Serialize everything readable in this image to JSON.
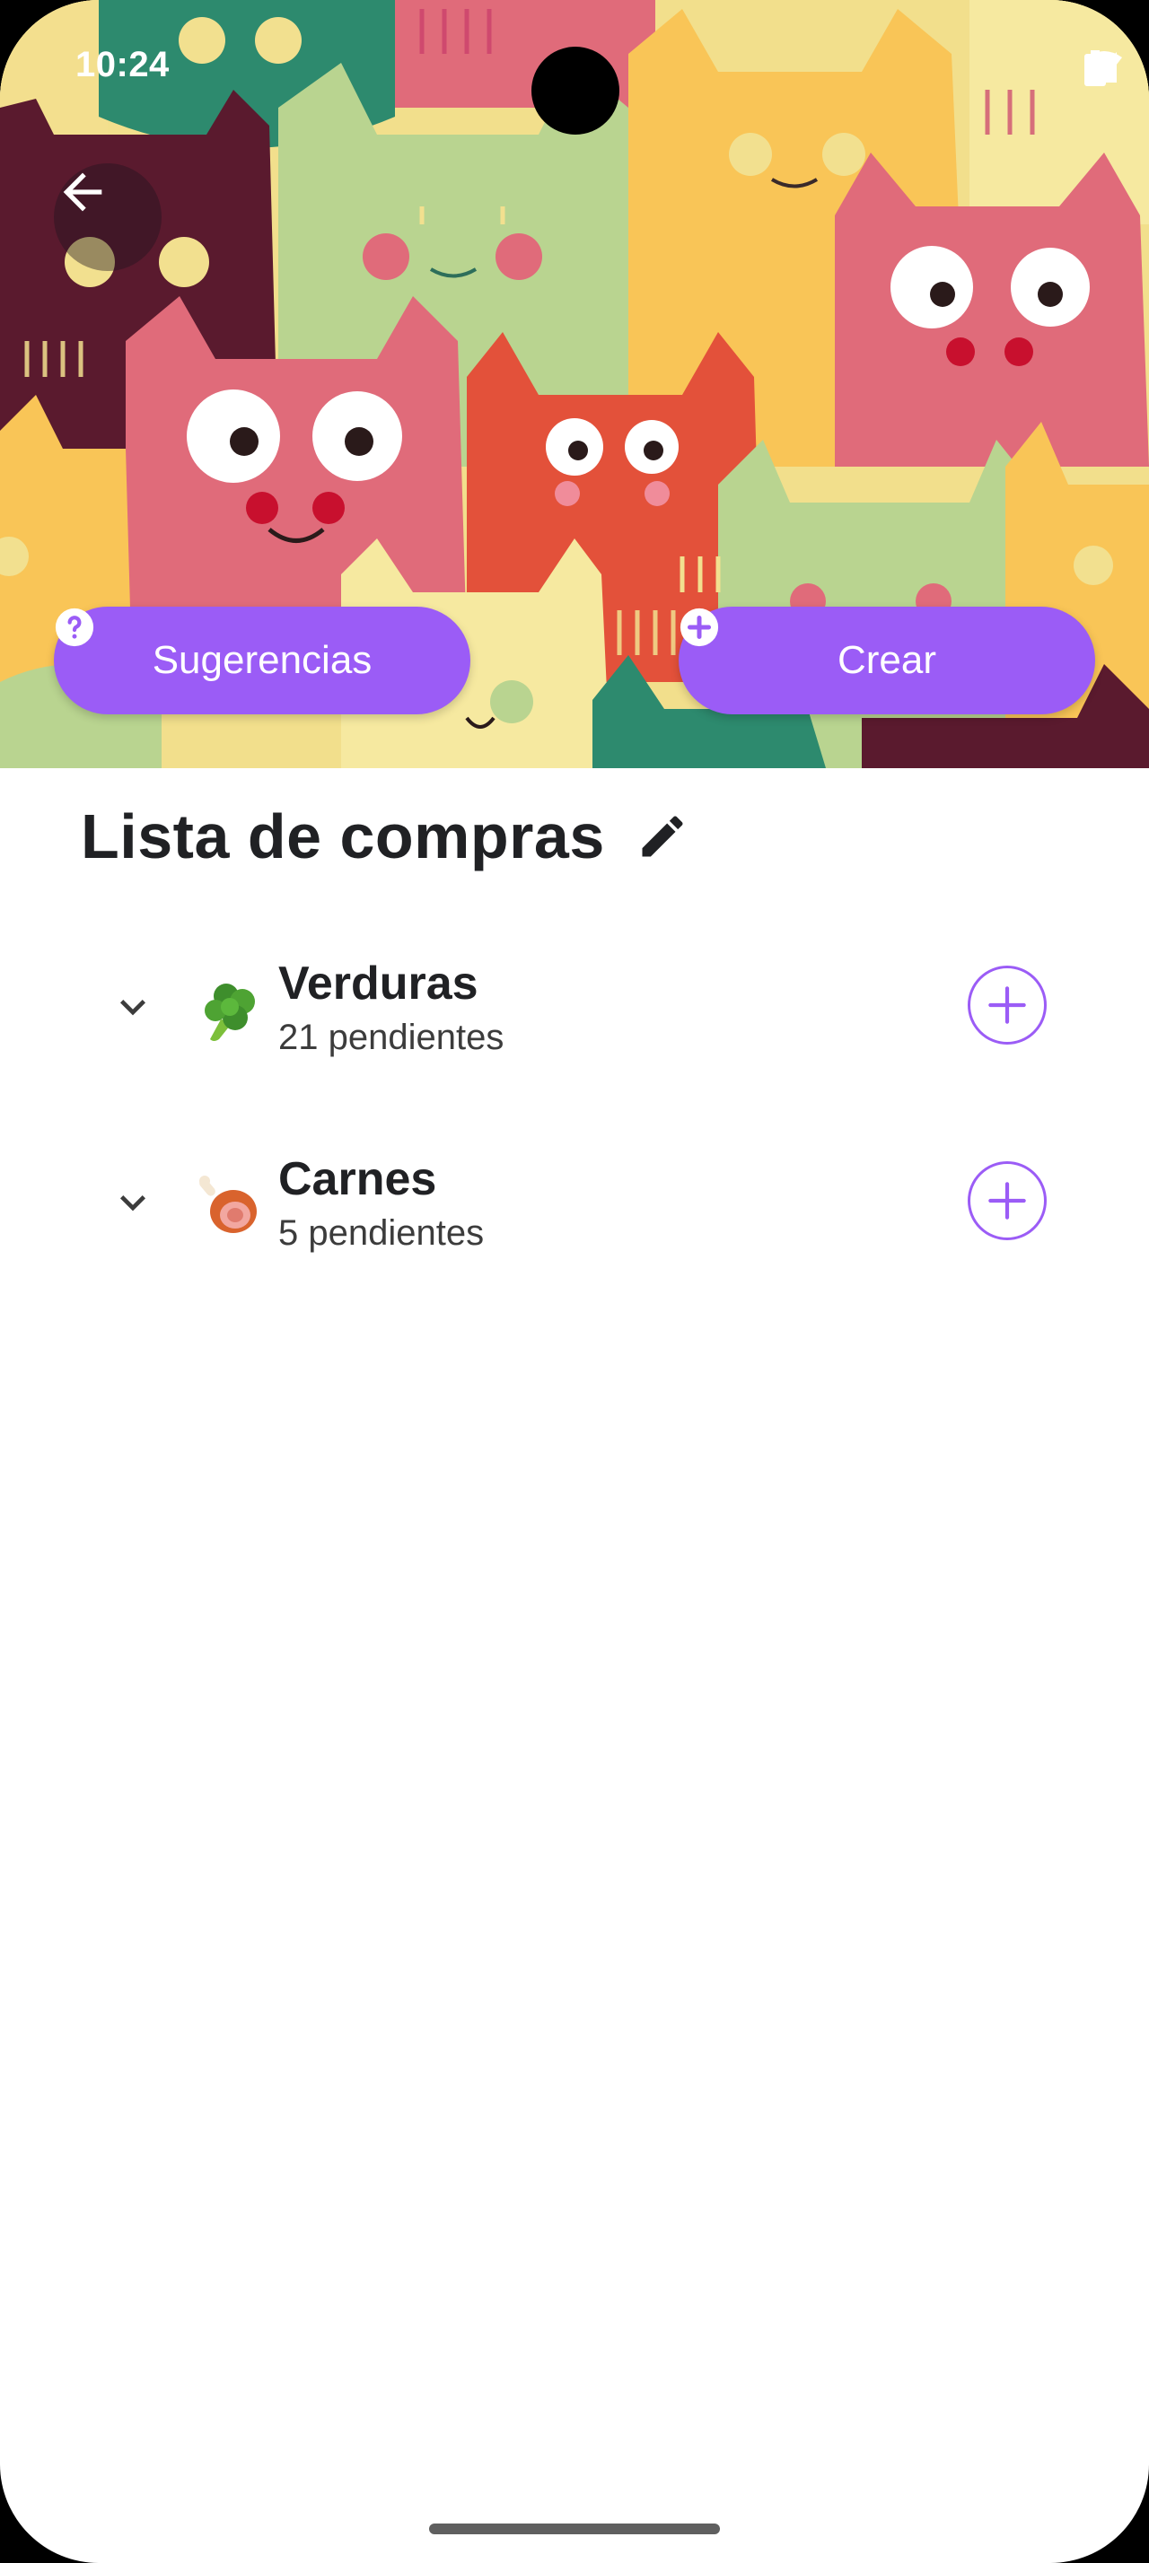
{
  "status_bar": {
    "time": "10:24"
  },
  "header": {
    "back_icon": "arrow-left-icon",
    "suggestions_label": "Sugerencias",
    "suggestions_icon": "help-circle-icon",
    "create_label": "Crear",
    "create_icon": "add-circle-icon"
  },
  "list": {
    "title": "Lista de compras",
    "edit_icon": "pencil-icon",
    "categories": [
      {
        "name": "Verduras",
        "count": "21 pendientes",
        "emoji": "broccoli-icon"
      },
      {
        "name": "Carnes",
        "count": "5 pendientes",
        "emoji": "meat-on-bone-icon"
      }
    ]
  },
  "colors": {
    "accent": "#9b5cf6",
    "text": "#202124",
    "background": "#ffffff"
  }
}
